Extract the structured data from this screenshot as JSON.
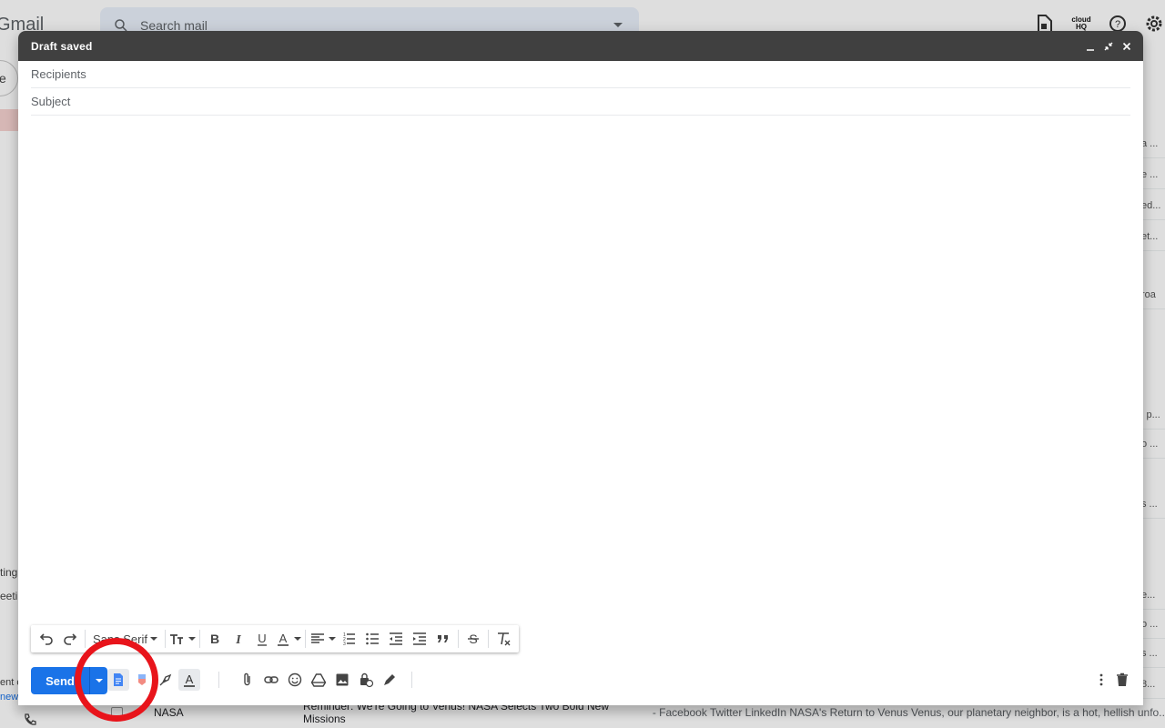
{
  "background": {
    "logo_text": "Gmail",
    "search_placeholder": "Search mail",
    "compose_pill_text": "e",
    "side_texts": [
      "ting",
      "eetin",
      "ent cl",
      "new"
    ],
    "row_snippets": [
      "a ...",
      "e ...",
      "ed...",
      "et...",
      "roa",
      "l p...",
      "o ...",
      "s ...",
      "e...",
      "o ...",
      "s ...",
      "8..."
    ],
    "bottom_row": {
      "sender": "NASA",
      "subject": "Reminder: We're Going to Venus! NASA Selects Two Bold New Missions",
      "snippet": " - Facebook  Twitter  LinkedIn  NASA's Return to Venus Venus, our planetary neighbor, is a hot, hellish unfo..."
    },
    "topbar_icons": [
      "support-icon",
      "cloudhq-icon",
      "help-icon",
      "settings-icon"
    ],
    "cloudhq_label": "cloud HQ"
  },
  "compose": {
    "title": "Draft saved",
    "recipients_label": "Recipients",
    "subject_label": "Subject",
    "font_name": "Sans Serif",
    "send_label": "Send",
    "formatting_buttons": [
      "undo",
      "redo",
      "font",
      "text-size",
      "bold",
      "italic",
      "underline",
      "text-color",
      "align",
      "numbered-list",
      "bulleted-list",
      "indent-less",
      "indent-more",
      "quote",
      "strikethrough",
      "remove-formatting"
    ],
    "action_buttons": [
      "docs-template",
      "cloudhq-stamp",
      "brush",
      "formatting-options",
      "attach",
      "link",
      "emoji",
      "drive",
      "photo",
      "confidential",
      "signature",
      "more-options",
      "discard"
    ]
  },
  "annotation": {
    "color": "#e8141b"
  }
}
